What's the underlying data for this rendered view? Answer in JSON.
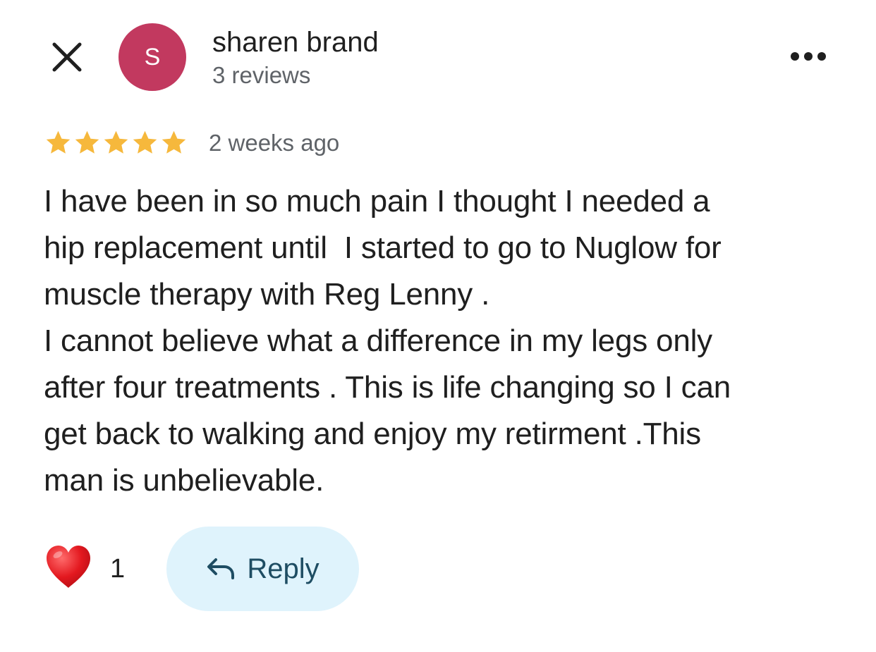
{
  "header": {
    "close_icon": "close-icon",
    "more_icon": "more-horizontal-icon"
  },
  "reviewer": {
    "avatar_initial": "S",
    "avatar_color": "#c2395f",
    "name": "sharen brand",
    "review_count": "3 reviews"
  },
  "review": {
    "rating": 5,
    "rating_max": 5,
    "star_color": "#f6b83c",
    "date": "2 weeks ago",
    "text": "I have been in so much pain I thought I needed a\nhip replacement until  I started to go to Nuglow for\nmuscle therapy with Reg Lenny .\nI cannot believe what a difference in my legs only\nafter four treatments . This is life changing so I can\nget back to walking and enjoy my retirment .This\nman is unbelievable."
  },
  "actions": {
    "like_icon": "heart-icon",
    "like_count": "1",
    "reply_icon": "reply-arrow-icon",
    "reply_label": "Reply",
    "reply_bg": "#dff3fc",
    "reply_color": "#1e4d63"
  }
}
